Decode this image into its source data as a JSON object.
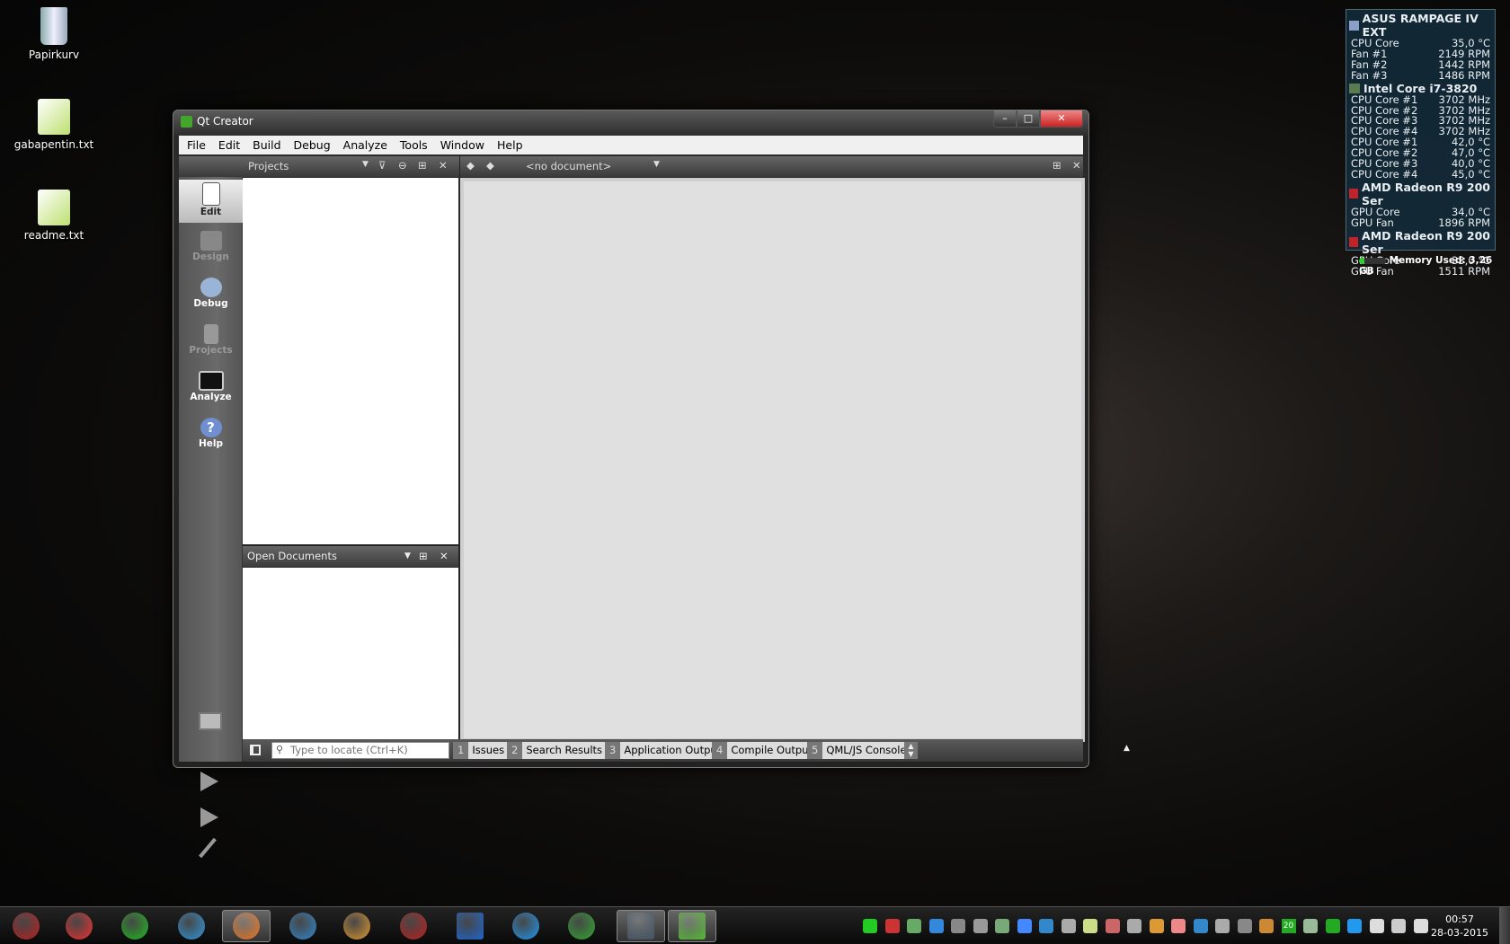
{
  "desktop": {
    "icons": [
      {
        "label": "Papirkurv",
        "icon": "recycle-bin-icon"
      },
      {
        "label": "gabapentin.txt",
        "icon": "text-file-icon"
      },
      {
        "label": "readme.txt",
        "icon": "text-file-icon"
      }
    ]
  },
  "window": {
    "title": "Qt Creator",
    "controls": {
      "minimize": "–",
      "maximize": "□",
      "close": "✕"
    },
    "menu": [
      "File",
      "Edit",
      "Build",
      "Debug",
      "Analyze",
      "Tools",
      "Window",
      "Help"
    ],
    "projects_pane": {
      "title": "Projects"
    },
    "open_documents": {
      "title": "Open Documents"
    },
    "editor": {
      "document": "<no document>"
    },
    "modes": [
      {
        "label": "Edit",
        "active": true
      },
      {
        "label": "Design",
        "disabled": true
      },
      {
        "label": "Debug"
      },
      {
        "label": "Projects",
        "disabled": true
      },
      {
        "label": "Analyze"
      },
      {
        "label": "Help"
      }
    ],
    "locator": {
      "placeholder": "Type to locate (Ctrl+K)"
    },
    "output_tabs": [
      {
        "num": "1",
        "label": "Issues"
      },
      {
        "num": "2",
        "label": "Search Results"
      },
      {
        "num": "3",
        "label": "Application Output"
      },
      {
        "num": "4",
        "label": "Compile Output"
      },
      {
        "num": "5",
        "label": "QML/JS Console"
      }
    ]
  },
  "sensors": {
    "groups": [
      {
        "title": "ASUS RAMPAGE IV EXT",
        "color": "#8aa0c8",
        "rows": [
          [
            "CPU Core",
            "35,0 °C"
          ],
          [
            "Fan #1",
            "2149 RPM"
          ],
          [
            "Fan #2",
            "1442 RPM"
          ],
          [
            "Fan #3",
            "1486 RPM"
          ]
        ]
      },
      {
        "title": "Intel Core i7-3820",
        "color": "#5a7a50",
        "rows": [
          [
            "CPU Core #1",
            "3702 MHz"
          ],
          [
            "CPU Core #2",
            "3702 MHz"
          ],
          [
            "CPU Core #3",
            "3702 MHz"
          ],
          [
            "CPU Core #4",
            "3702 MHz"
          ],
          [
            "CPU Core #1",
            "42,0 °C"
          ],
          [
            "CPU Core #2",
            "47,0 °C"
          ],
          [
            "CPU Core #3",
            "40,0 °C"
          ],
          [
            "CPU Core #4",
            "45,0 °C"
          ]
        ]
      },
      {
        "title": "AMD Radeon R9 200 Ser",
        "color": "#c0242a",
        "rows": [
          [
            "GPU Core",
            "34,0 °C"
          ],
          [
            "GPU Fan",
            "1896 RPM"
          ]
        ]
      },
      {
        "title": "AMD Radeon R9 200 Ser",
        "color": "#c0242a",
        "rows": [
          [
            "GPU Core",
            "33,0 °C"
          ],
          [
            "GPU Fan",
            "1511 RPM"
          ]
        ]
      }
    ],
    "memory": "Memory Used: 3,26 GB",
    "memory_fraction": 0.2
  },
  "taskbar": {
    "apps": [
      "start-orb",
      "task-list",
      "spreadsheet",
      "internet-explorer",
      "firefox",
      "thunderbird",
      "media-player",
      "gear-app",
      "beyond-compare",
      "ccleaner",
      "power-app",
      "editor-app",
      "qt-creator"
    ],
    "clock": {
      "time": "00:57",
      "date": "28-03-2015"
    },
    "tray_badge": "20"
  }
}
